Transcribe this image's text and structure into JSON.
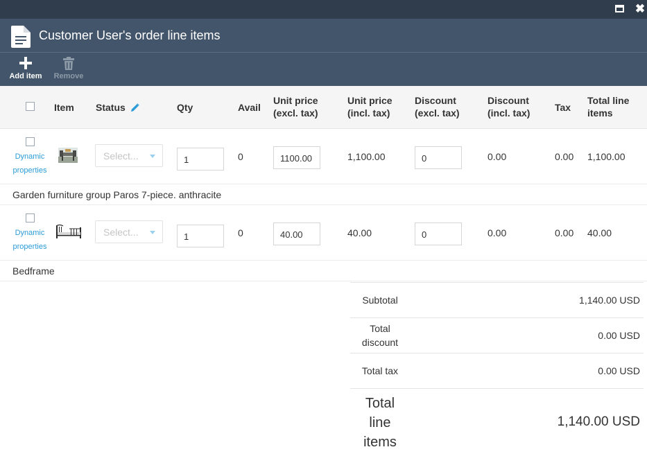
{
  "window": {
    "maximize_icon": "maximize-icon",
    "close_icon": "close-icon",
    "title": "Customer User's order line items"
  },
  "toolbar": {
    "add_label": "Add item",
    "remove_label": "Remove"
  },
  "table": {
    "headers": {
      "item": "Item",
      "status": "Status",
      "qty": "Qty",
      "avail": "Avail",
      "unit_price_excl_1": "Unit price",
      "unit_price_excl_2": "(excl. tax)",
      "unit_price_incl_1": "Unit price",
      "unit_price_incl_2": "(incl. tax)",
      "discount_excl_1": "Discount",
      "discount_excl_2": "(excl. tax)",
      "discount_incl_1": "Discount",
      "discount_incl_2": "(incl. tax)",
      "tax": "Tax",
      "total_1": "Total line",
      "total_2": "items"
    },
    "rows": [
      {
        "dynamic_1": "Dynamic",
        "dynamic_2": "properties",
        "status_placeholder": "Select...",
        "qty": "1",
        "avail": "0",
        "unit_price_excl": "1100.00",
        "unit_price_incl": "1,100.00",
        "discount_excl": "0",
        "discount_incl": "0.00",
        "tax": "0.00",
        "total": "1,100.00",
        "name": "Garden furniture group Paros 7-piece. anthracite"
      },
      {
        "dynamic_1": "Dynamic",
        "dynamic_2": "properties",
        "status_placeholder": "Select...",
        "qty": "1",
        "avail": "0",
        "unit_price_excl": "40.00",
        "unit_price_incl": "40.00",
        "discount_excl": "0",
        "discount_incl": "0.00",
        "tax": "0.00",
        "total": "40.00",
        "name": "Bedframe"
      }
    ]
  },
  "totals": {
    "subtotal_label": "Subtotal",
    "subtotal_value": "1,140.00 USD",
    "discount_label_1": "Total",
    "discount_label_2": "discount",
    "discount_value": "0.00 USD",
    "tax_label": "Total tax",
    "tax_value": "0.00 USD",
    "grand_label_1": "Total",
    "grand_label_2": "line",
    "grand_label_3": "items",
    "grand_value": "1,140.00 USD"
  },
  "colors": {
    "topbar": "#2f3d4c",
    "header": "#43556a",
    "link": "#2b9cd8"
  }
}
